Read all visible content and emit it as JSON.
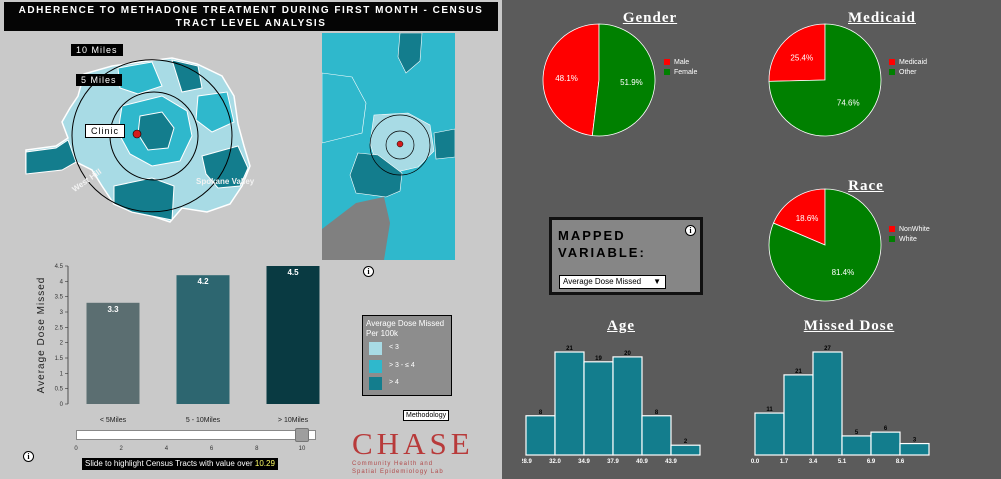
{
  "header": {
    "title": "ADHERENCE TO METHADONE TREATMENT DURING FIRST MONTH - CENSUS TRACT LEVEL ANALYSIS"
  },
  "map": {
    "labels": {
      "ring_10": "10 Miles",
      "ring_5": "5 Miles",
      "clinic": "Clinic",
      "west_hill": "West Hill",
      "spokane_valley": "Spokane Valley"
    },
    "colors": {
      "light": "#a8dbe5",
      "mid": "#2fb8cc",
      "dark": "#137d8d",
      "outline": "#ffffff",
      "clinic_marker": "#d41c1c"
    }
  },
  "left_chart": {
    "chart_data": {
      "type": "bar",
      "categories": [
        "< 5Miles",
        "5 - 10Miles",
        "> 10Miles"
      ],
      "values": [
        3.3,
        4.2,
        4.5
      ],
      "value_labels": [
        "3.3",
        "4.2",
        "4.5"
      ],
      "ylabel": "Average Dose Missed",
      "ylim": [
        0,
        4.5
      ],
      "yticks": [
        "0",
        "0.5",
        "1",
        "1.5",
        "2",
        "2.5",
        "3",
        "3.5",
        "4",
        "4.5"
      ],
      "colors": [
        "#5b6e71",
        "#2d6670",
        "#093a42"
      ]
    }
  },
  "map_legend": {
    "title": "Average Dose Missed",
    "subtitle": "Per 100k",
    "items": [
      {
        "label": "< 3",
        "color": "#a8dbe5"
      },
      {
        "label": "> 3 - ≤ 4",
        "color": "#2fb8cc"
      },
      {
        "label": "> 4",
        "color": "#137d8d"
      }
    ]
  },
  "methodology_label": "Methodology",
  "slider": {
    "ticks": [
      "0",
      "2",
      "4",
      "6",
      "8",
      "10"
    ],
    "caption_prefix": "Slide to highlight Census Tracts with value over ",
    "value": "10.29",
    "fraction": 0.97
  },
  "logo": {
    "word": "CHASE",
    "line1": "Community Health and",
    "line2": "Spatial Epidemiology Lab"
  },
  "gender": {
    "title": "Gender",
    "chart_data": {
      "type": "pie",
      "labels": [
        "Male",
        "Female"
      ],
      "values": [
        48.1,
        51.9
      ],
      "value_labels": [
        "48.1%",
        "51.9%"
      ],
      "colors": [
        "#ff0000",
        "#008000"
      ]
    }
  },
  "medicaid": {
    "title": "Medicaid",
    "chart_data": {
      "type": "pie",
      "labels": [
        "Medicaid",
        "Other"
      ],
      "values": [
        25.4,
        74.6
      ],
      "value_labels": [
        "25.4%",
        "74.6%"
      ],
      "colors": [
        "#ff0000",
        "#008000"
      ]
    }
  },
  "race": {
    "title": "Race",
    "chart_data": {
      "type": "pie",
      "labels": [
        "NonWhite",
        "White"
      ],
      "values": [
        18.6,
        81.4
      ],
      "value_labels": [
        "18.6%",
        "81.4%"
      ],
      "colors": [
        "#ff0000",
        "#008000"
      ]
    }
  },
  "mapped_variable": {
    "title_line1": "MAPPED",
    "title_line2": "VARIABLE:",
    "selected": "Average Dose Missed"
  },
  "age": {
    "title": "Age",
    "chart_data": {
      "type": "bar",
      "categories": [
        "28.9",
        "32.0",
        "34.9",
        "37.9",
        "40.9",
        "43.9"
      ],
      "values": [
        8,
        21,
        19,
        20,
        8,
        2
      ],
      "value_labels": [
        "8",
        "21",
        "19",
        "20",
        "8",
        "2"
      ],
      "color": "#137d8d"
    }
  },
  "missed_dose": {
    "title": "Missed Dose",
    "chart_data": {
      "type": "bar",
      "categories": [
        "0.0",
        "1.7",
        "3.4",
        "5.1",
        "6.9",
        "8.6"
      ],
      "values": [
        11,
        21,
        27,
        5,
        6,
        3
      ],
      "value_labels": [
        "11",
        "21",
        "27",
        "5",
        "6",
        "3"
      ],
      "color": "#137d8d"
    }
  }
}
